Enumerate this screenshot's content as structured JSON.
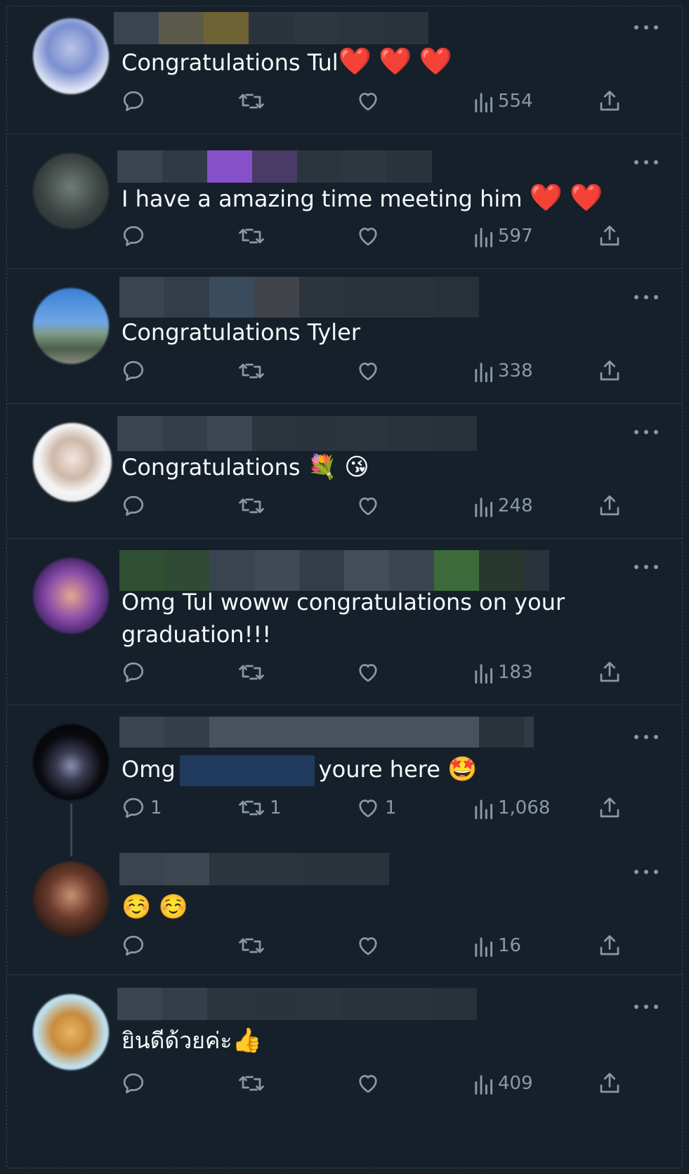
{
  "replies": [
    {
      "text": "Congratulations Tul",
      "emojis": [
        "❤️",
        "❤️",
        "❤️"
      ],
      "views": "554",
      "replies_count": "",
      "retweets_count": "",
      "likes_count": ""
    },
    {
      "text": "I have a amazing time meeting him",
      "emojis": [
        "❤️",
        "❤️"
      ],
      "views": "597",
      "replies_count": "",
      "retweets_count": "",
      "likes_count": ""
    },
    {
      "text": "Congratulations Tyler",
      "emojis": [],
      "views": "338",
      "replies_count": "",
      "retweets_count": "",
      "likes_count": ""
    },
    {
      "text": "Congratulations",
      "emojis": [
        "💐",
        "😘"
      ],
      "views": "248",
      "replies_count": "",
      "retweets_count": "",
      "likes_count": ""
    },
    {
      "text": "Omg Tul woww congratulations on your graduation!!!",
      "emojis": [],
      "views": "183",
      "replies_count": "",
      "retweets_count": "",
      "likes_count": ""
    },
    {
      "text_before": "Omg",
      "text_after": "youre here",
      "emojis": [
        "🤩"
      ],
      "views": "1,068",
      "replies_count": "1",
      "retweets_count": "1",
      "likes_count": "1"
    },
    {
      "text": "",
      "emojis": [
        "☺️",
        "☺️"
      ],
      "views": "16",
      "replies_count": "",
      "retweets_count": "",
      "likes_count": ""
    },
    {
      "text": "ยินดีด้วยค่ะ",
      "emojis": [
        "👍"
      ],
      "views": "409",
      "replies_count": "",
      "retweets_count": "",
      "likes_count": ""
    }
  ],
  "icons": {
    "reply": "reply-icon",
    "retweet": "retweet-icon",
    "like": "heart-icon",
    "views": "views-icon",
    "share": "share-icon",
    "more": "more-icon"
  },
  "colors": {
    "background": "#15202b",
    "text": "#f7f9f9",
    "secondary": "#8b98a5",
    "divider": "#2b3640"
  }
}
